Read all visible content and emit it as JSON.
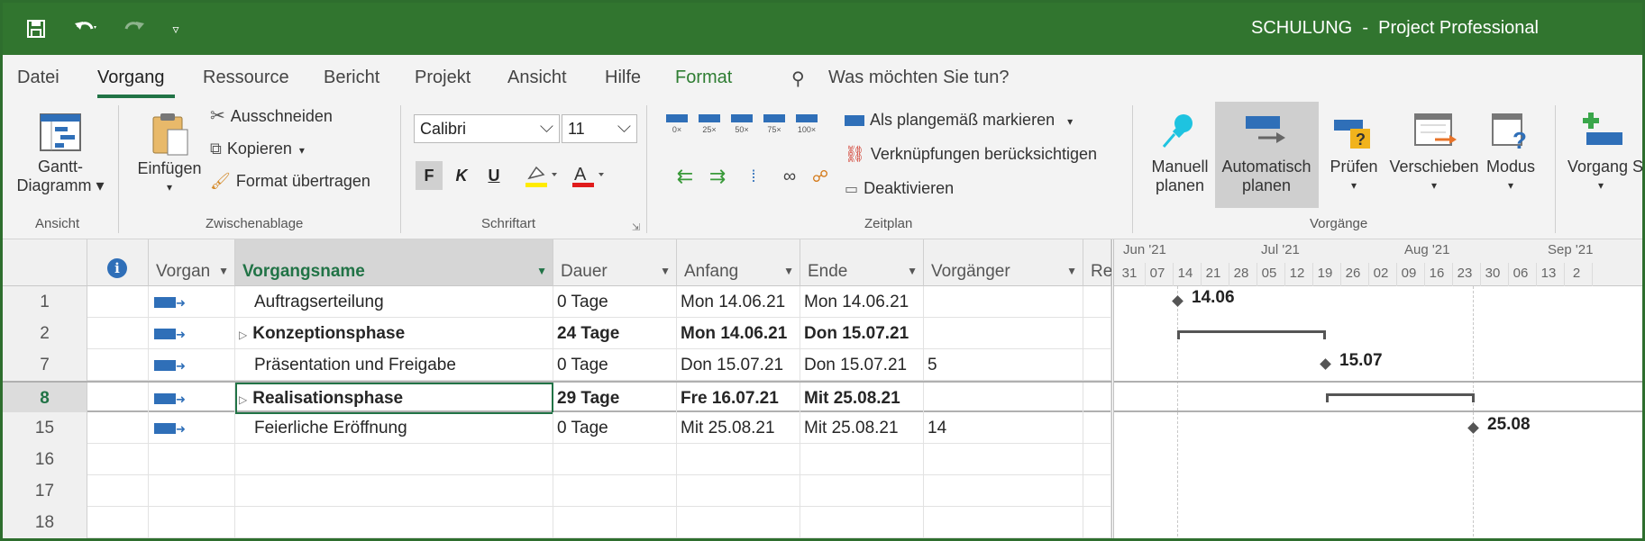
{
  "window": {
    "title": "SCHULUNG  -  Project Professional"
  },
  "menu": {
    "tabs": [
      "Datei",
      "Vorgang",
      "Ressource",
      "Bericht",
      "Projekt",
      "Ansicht",
      "Hilfe",
      "Format"
    ],
    "active": "Vorgang",
    "search_placeholder": "Was möchten Sie tun?"
  },
  "ribbon": {
    "ansicht": {
      "gantt_line1": "Gantt-",
      "gantt_line2": "Diagramm ▾",
      "group": "Ansicht"
    },
    "zwischenablage": {
      "einfuegen": "Einfügen",
      "ausschneiden": "Ausschneiden",
      "kopieren": "Kopieren",
      "format_uebertragen": "Format übertragen",
      "group": "Zwischenablage"
    },
    "schriftart": {
      "font": "Calibri",
      "size": "11",
      "bold": "F",
      "italic": "K",
      "underline": "U",
      "group": "Schriftart"
    },
    "zeitplan": {
      "pct": [
        "0×",
        "25×",
        "50×",
        "75×",
        "100×"
      ],
      "als_plangemaess": "Als plangemäß markieren",
      "verknuepfungen": "Verknüpfungen berücksichtigen",
      "deaktivieren": "Deaktivieren",
      "group": "Zeitplan"
    },
    "vorgaenge": {
      "manuell_1": "Manuell",
      "manuell_2": "planen",
      "auto_1": "Automatisch",
      "auto_2": "planen",
      "pruefen": "Prüfen",
      "verschieben": "Verschieben",
      "modus": "Modus",
      "group": "Vorgänge",
      "vorgang": "Vorgang S"
    }
  },
  "grid": {
    "headers": {
      "info": "i",
      "mode": "Vorgan",
      "name": "Vorgangsname",
      "dauer": "Dauer",
      "anfang": "Anfang",
      "ende": "Ende",
      "vorgaenger": "Vorgänger",
      "re": "Re"
    },
    "rows": [
      {
        "id": "1",
        "name": "Auftragserteilung",
        "dauer": "0 Tage",
        "anfang": "Mon 14.06.21",
        "ende": "Mon 14.06.21",
        "vorg": "",
        "summary": false
      },
      {
        "id": "2",
        "name": "Konzeptionsphase",
        "dauer": "24 Tage",
        "anfang": "Mon 14.06.21",
        "ende": "Don 15.07.21",
        "vorg": "",
        "summary": true
      },
      {
        "id": "7",
        "name": "Präsentation und Freigabe",
        "dauer": "0 Tage",
        "anfang": "Don 15.07.21",
        "ende": "Don 15.07.21",
        "vorg": "5",
        "summary": false
      },
      {
        "id": "8",
        "name": "Realisationsphase",
        "dauer": "29 Tage",
        "anfang": "Fre 16.07.21",
        "ende": "Mit 25.08.21",
        "vorg": "",
        "summary": true
      },
      {
        "id": "15",
        "name": "Feierliche Eröffnung",
        "dauer": "0 Tage",
        "anfang": "Mit 25.08.21",
        "ende": "Mit 25.08.21",
        "vorg": "14",
        "summary": false
      },
      {
        "id": "16",
        "name": "",
        "dauer": "",
        "anfang": "",
        "ende": "",
        "vorg": "",
        "summary": false
      },
      {
        "id": "17",
        "name": "",
        "dauer": "",
        "anfang": "",
        "ende": "",
        "vorg": "",
        "summary": false
      },
      {
        "id": "18",
        "name": "",
        "dauer": "",
        "anfang": "",
        "ende": "",
        "vorg": "",
        "summary": false
      }
    ]
  },
  "gantt": {
    "months": [
      "Jun '21",
      "Jul '21",
      "Aug '21",
      "Sep '21"
    ],
    "weeks": [
      "31",
      "07",
      "14",
      "21",
      "28",
      "05",
      "12",
      "19",
      "26",
      "02",
      "09",
      "16",
      "23",
      "30",
      "06",
      "13",
      "2"
    ],
    "labels": {
      "m1": "14.06",
      "m2": "15.07",
      "m3": "25.08"
    }
  },
  "colors": {
    "titlebar": "#31752f",
    "accent": "#217346",
    "task_icon": "#2f6fb8"
  }
}
